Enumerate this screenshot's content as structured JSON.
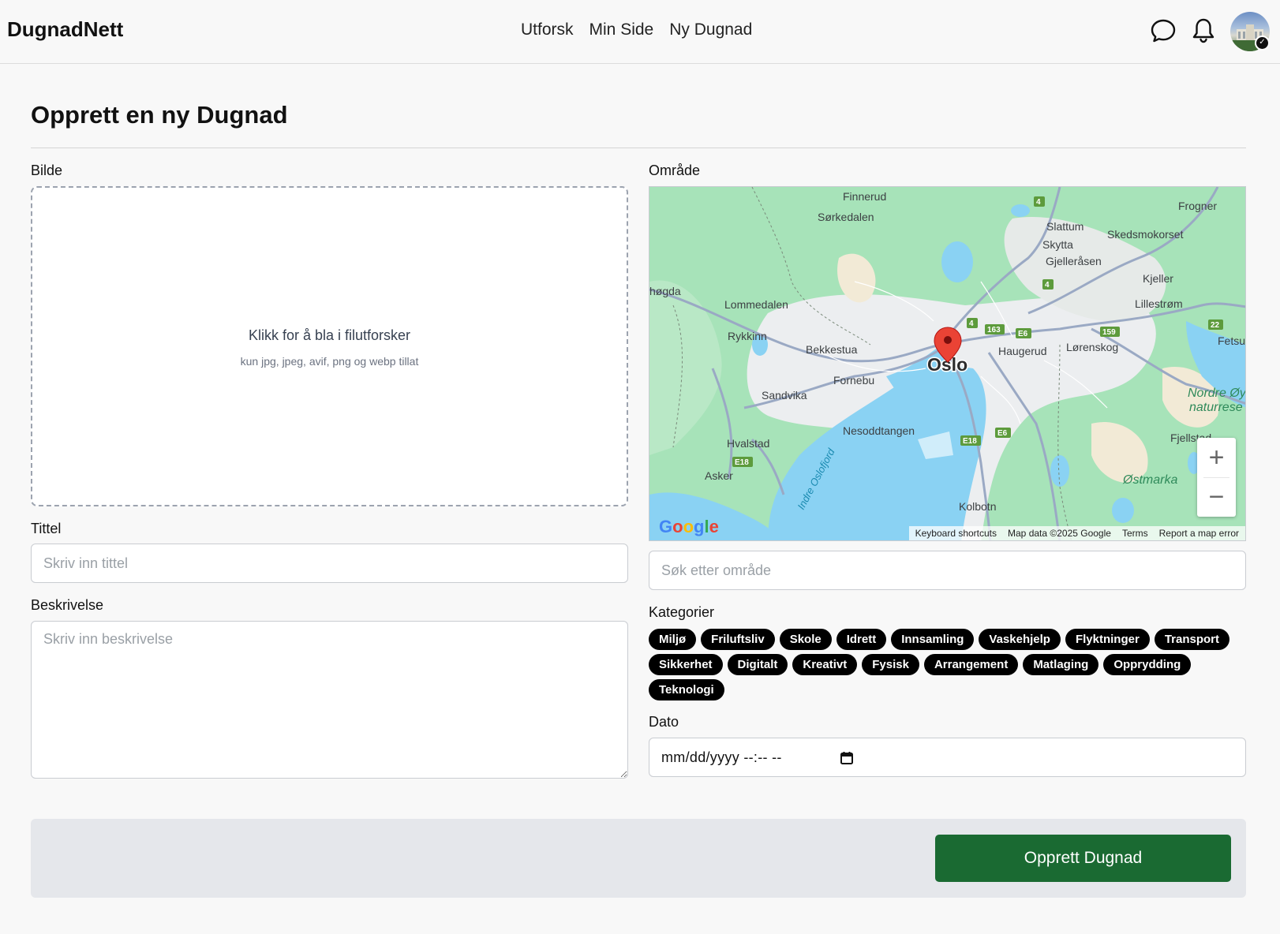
{
  "nav": {
    "brand": "DugnadNett",
    "links": [
      "Utforsk",
      "Min Side",
      "Ny Dugnad"
    ]
  },
  "page": {
    "title": "Opprett en ny Dugnad"
  },
  "image_upload": {
    "label": "Bilde",
    "main_text": "Klikk for å bla i filutforsker",
    "sub_text": "kun jpg, jpeg, avif, png og webp tillat"
  },
  "title_field": {
    "label": "Tittel",
    "placeholder": "Skriv inn tittel",
    "value": ""
  },
  "description_field": {
    "label": "Beskrivelse",
    "placeholder": "Skriv inn beskrivelse",
    "value": ""
  },
  "area": {
    "label": "Område",
    "search_placeholder": "Søk etter område",
    "map": {
      "place_labels": [
        "Finnerud",
        "Sørkedalen",
        "Frogner",
        "Slattum",
        "Skytta",
        "Gjelleråsen",
        "Skedsmokorset",
        "Kjeller",
        "Lillestrøm",
        "høgda",
        "Lommedalen",
        "Rykkinn",
        "Bekkestua",
        "Oslo",
        "Haugerud",
        "Lørenskog",
        "Fornebu",
        "Sandvika",
        "Nesoddtangen",
        "Hvalstad",
        "Asker",
        "Kolbotn",
        "Fjellstad",
        "Østmarka",
        "Nordre Øy naturrese",
        "Fetsu",
        "Indre Oslofjord"
      ],
      "road_shields": [
        "4",
        "4",
        "4",
        "163",
        "E6",
        "159",
        "22",
        "E6",
        "E18",
        "E18"
      ],
      "logo": "Google",
      "footer": [
        "Keyboard shortcuts",
        "Map data ©2025 Google",
        "Terms",
        "Report a map error"
      ]
    }
  },
  "categories": {
    "label": "Kategorier",
    "items": [
      "Miljø",
      "Friluftsliv",
      "Skole",
      "Idrett",
      "Innsamling",
      "Vaskehjelp",
      "Flyktninger",
      "Transport",
      "Sikkerhet",
      "Digitalt",
      "Kreativt",
      "Fysisk",
      "Arrangement",
      "Matlaging",
      "Opprydding",
      "Teknologi"
    ]
  },
  "date_field": {
    "label": "Dato",
    "value": "mm/dd/yyyy --:-- --"
  },
  "submit": {
    "label": "Opprett Dugnad"
  },
  "colors": {
    "submit_bg": "#1a6a32",
    "chip_bg": "#000000",
    "map_green": "#a7e3b9",
    "map_water": "#8ad2f3"
  },
  "icons": {
    "chat": "chat-bubble-icon",
    "bell": "bell-icon",
    "calendar": "calendar-icon",
    "pin": "map-pin-icon"
  }
}
